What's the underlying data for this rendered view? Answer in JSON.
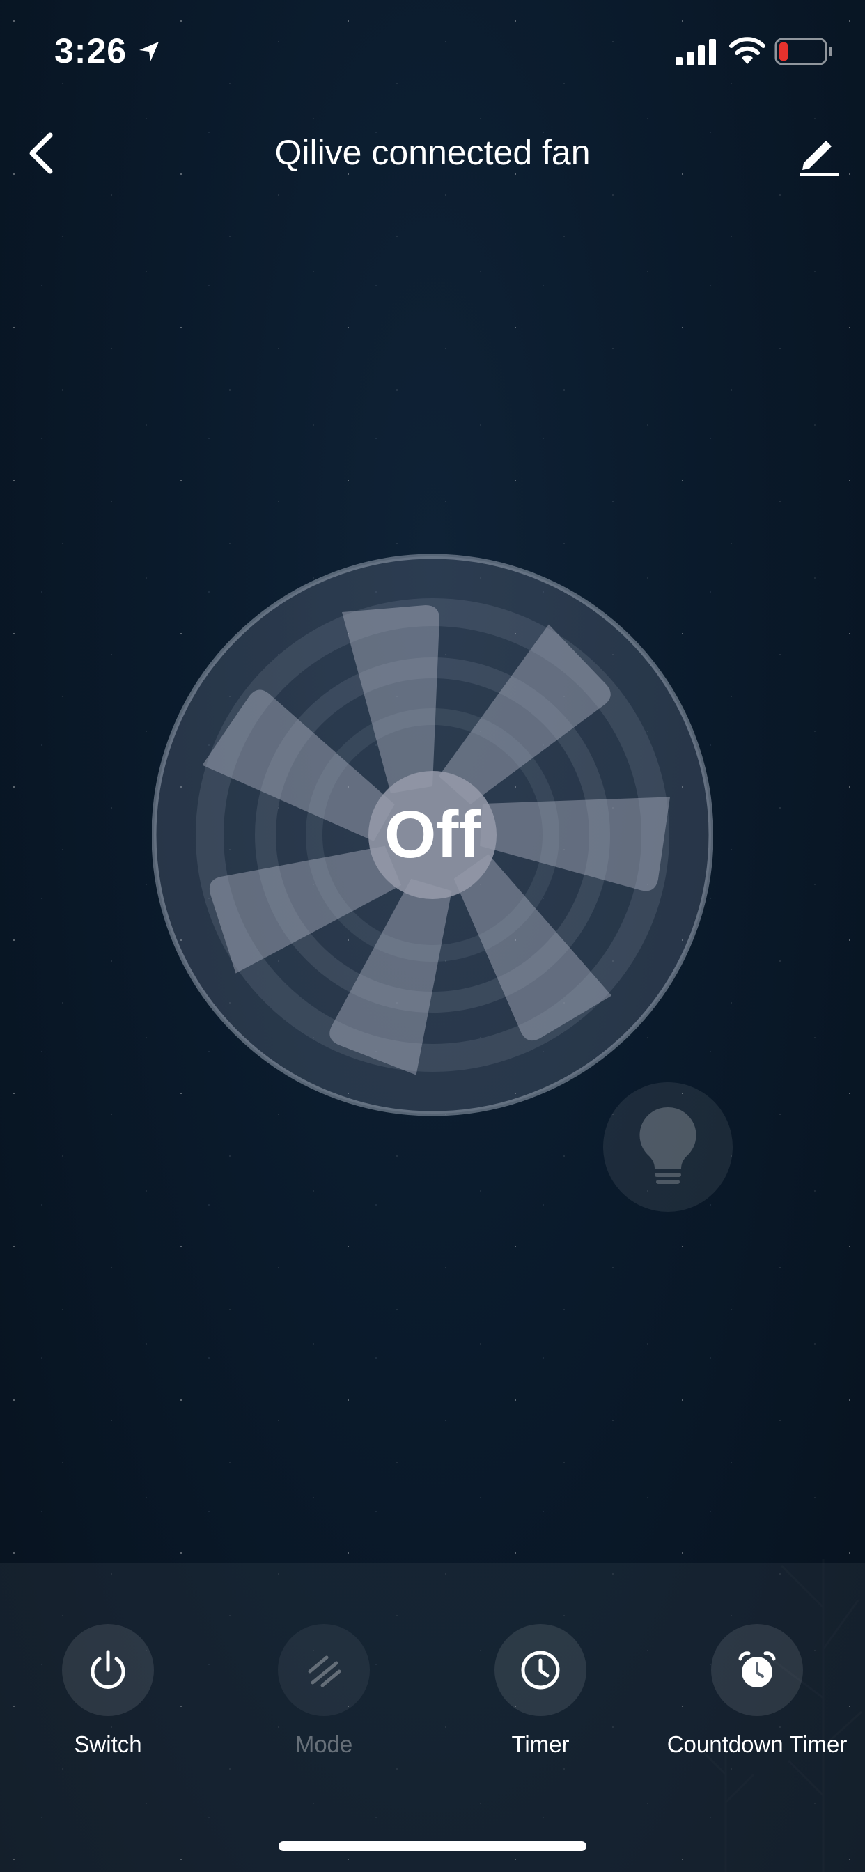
{
  "status_bar": {
    "time": "3:26",
    "icons": [
      "location-arrow-icon",
      "cellular-signal-icon",
      "wifi-icon",
      "battery-low-icon"
    ],
    "battery_color": "#e5322d"
  },
  "nav": {
    "title": "Qilive connected fan",
    "back_icon": "chevron-left-icon",
    "edit_icon": "pencil-icon"
  },
  "fan": {
    "state_label": "Off",
    "icon": "fan-icon"
  },
  "light_button": {
    "icon": "lightbulb-icon"
  },
  "controls": [
    {
      "label": "Switch",
      "icon": "power-icon",
      "enabled": true
    },
    {
      "label": "Mode",
      "icon": "mode-icon",
      "enabled": false
    },
    {
      "label": "Timer",
      "icon": "clock-icon",
      "enabled": true
    },
    {
      "label": "Countdown Timer",
      "icon": "alarm-clock-icon",
      "enabled": true
    }
  ],
  "colors": {
    "background": "#0a1a2b",
    "accent_white": "#ffffff"
  }
}
